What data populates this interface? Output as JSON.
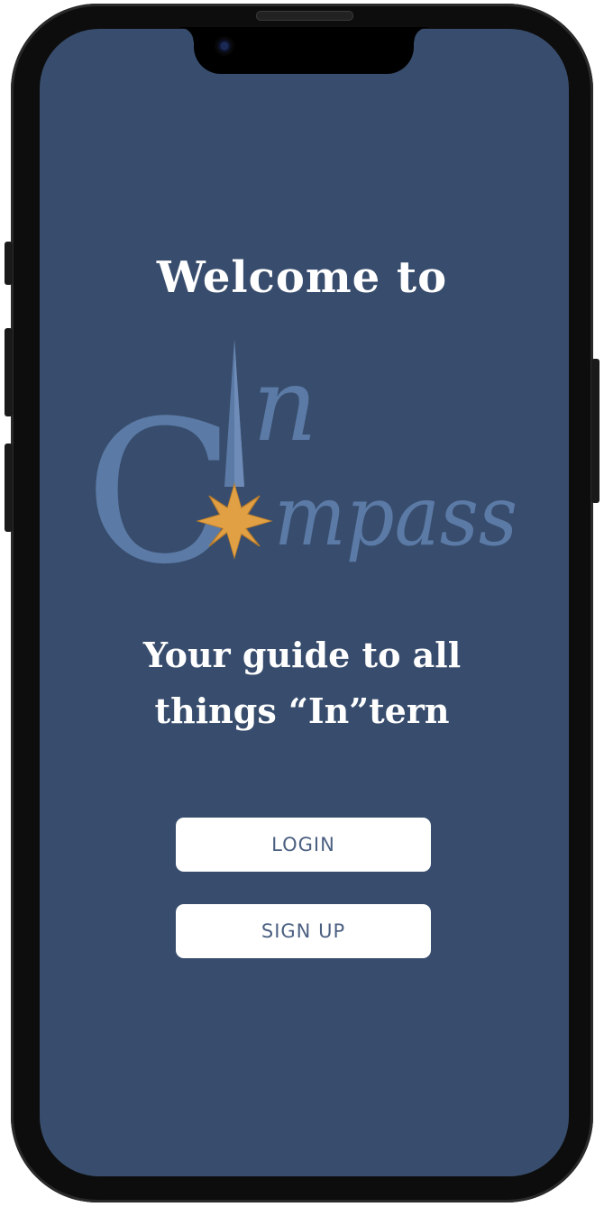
{
  "welcome_title": "Welcome to",
  "logo": {
    "name": "InCompass",
    "text_c": "C",
    "text_in": "n",
    "text_rest": "mpass",
    "text_color": "#5b7aa6",
    "star_color": "#e1a043"
  },
  "tagline": {
    "line1": "Your guide to all",
    "line2": "things “In”tern"
  },
  "buttons": {
    "login_label": "LOGIN",
    "signup_label": "SIGN UP"
  },
  "colors": {
    "screen_background": "#384d6d",
    "button_background": "#ffffff",
    "button_text": "#4c6082"
  }
}
